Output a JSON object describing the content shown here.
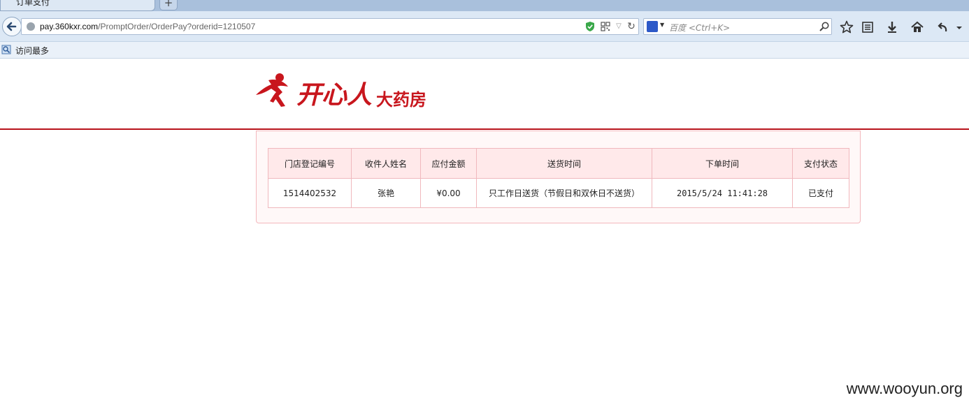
{
  "browser": {
    "tab_title": "订单支付",
    "new_tab_label": "+",
    "url_domain": "pay.360kxr.com",
    "url_path": "/PromptOrder/OrderPay?orderid=1210507",
    "search_placeholder": "百度 <Ctrl+K>",
    "bookmarks": [
      {
        "label": "访问最多"
      }
    ]
  },
  "logo": {
    "brand": "开心人",
    "tagline": "大药房",
    "color": "#c8161d"
  },
  "order_table": {
    "headers": [
      "门店登记编号",
      "收件人姓名",
      "应付金额",
      "送货时间",
      "下单时间",
      "支付状态"
    ],
    "row": {
      "store_id": "1514402532",
      "recipient": "张艳",
      "amount": "¥0.00",
      "delivery_time": "只工作日送货（节假日和双休日不送货）",
      "order_time": "2015/5/24 11:41:28",
      "status": "已支付"
    }
  },
  "watermark": "www.wooyun.org",
  "colors": {
    "accent": "#b8131b",
    "table_border": "#f0b8bd",
    "header_bg": "#ffe9ea"
  }
}
